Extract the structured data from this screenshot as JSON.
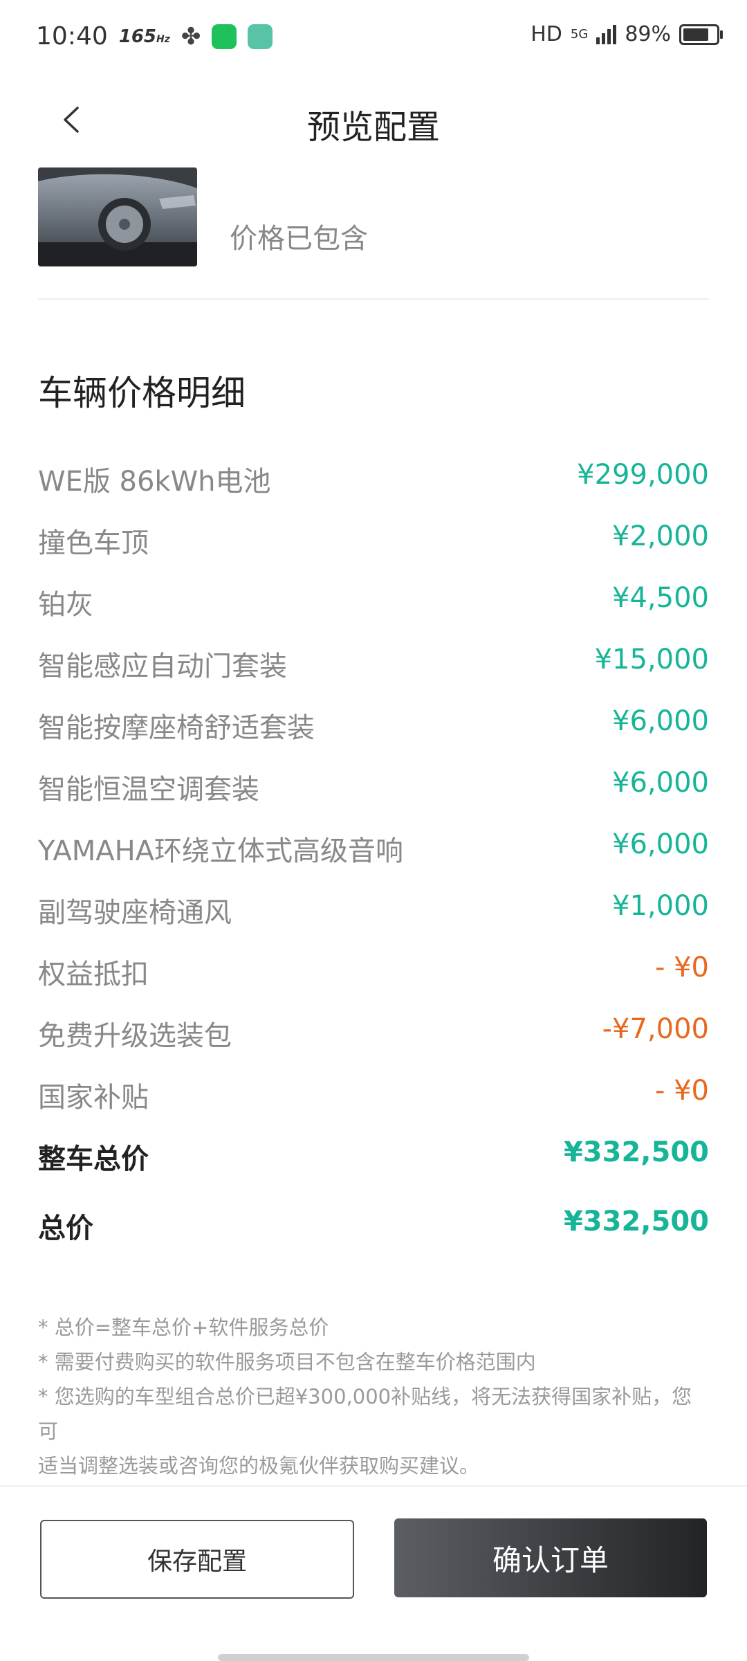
{
  "status_bar": {
    "time": "10:40",
    "refresh_rate": "165",
    "refresh_unit": "Hz",
    "hd": "HD",
    "network": "5G",
    "battery_text": "89%",
    "battery_level": 0.89
  },
  "header": {
    "title": "预览配置"
  },
  "preview": {
    "price_included": "价格已包含"
  },
  "breakdown": {
    "title": "车辆价格明细",
    "items": [
      {
        "label": "WE版 86kWh电池",
        "value": "¥299,000"
      },
      {
        "label": "撞色车顶",
        "value": "¥2,000"
      },
      {
        "label": "铂灰",
        "value": "¥4,500"
      },
      {
        "label": "智能感应自动门套装",
        "value": "¥15,000"
      },
      {
        "label": "智能按摩座椅舒适套装",
        "value": "¥6,000"
      },
      {
        "label": "智能恒温空调套装",
        "value": "¥6,000"
      },
      {
        "label": "YAMAHA环绕立体式高级音响",
        "value": "¥6,000"
      },
      {
        "label": "副驾驶座椅通风",
        "value": "¥1,000"
      },
      {
        "label": "权益抵扣",
        "value": "- ¥0"
      },
      {
        "label": "免费升级选装包",
        "value": "-¥7,000"
      },
      {
        "label": "国家补贴",
        "value": "- ¥0"
      }
    ],
    "vehicle_total_label": "整车总价",
    "vehicle_total_value": "¥332,500",
    "total_label": "总价",
    "total_value": "¥332,500"
  },
  "notes": [
    "* 总价=整车总价+软件服务总价",
    "* 需要付费购买的软件服务项目不包含在整车价格范围内",
    "* 您选购的车型组合总价已超¥300,000补贴线，将无法获得国家补贴，您可",
    "适当调整选装或咨询您的极氪伙伴获取购买建议。"
  ],
  "footer": {
    "save_label": "保存配置",
    "confirm_label": "确认订单"
  },
  "colors": {
    "positive": "#17b597",
    "negative": "#e8691e",
    "confirm_button": "#2c2e31"
  },
  "icons": [
    "back-arrow-icon",
    "fan-icon",
    "wechat-icon",
    "message-icon",
    "signal-icon",
    "battery-icon"
  ]
}
